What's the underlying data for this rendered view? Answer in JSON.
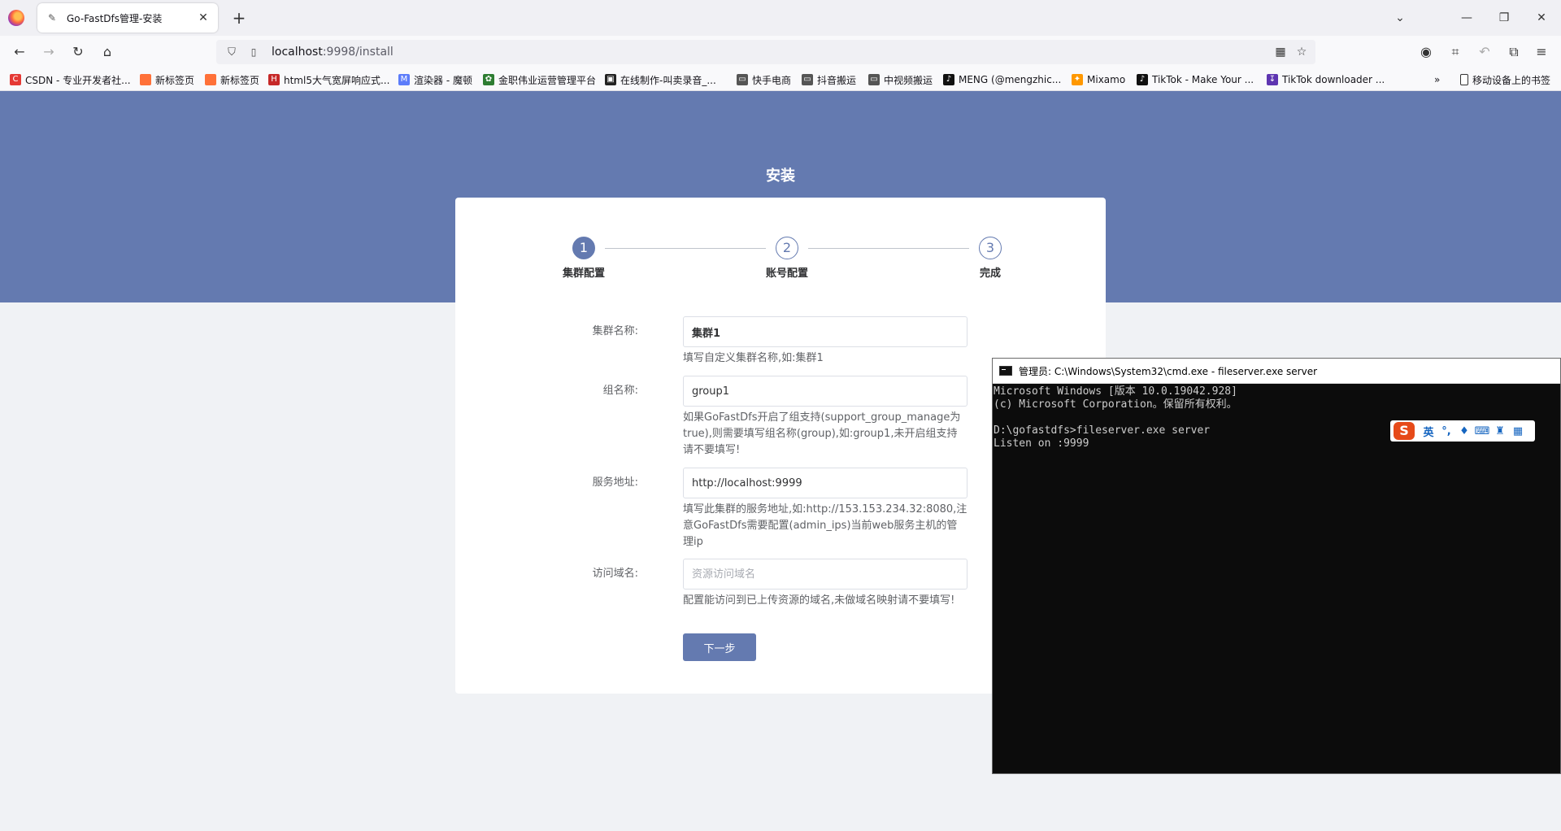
{
  "browser": {
    "tab_title": "Go-FastDfs管理-安装",
    "url_host": "localhost",
    "url_path": ":9998/install",
    "bookmarks": [
      {
        "label": "CSDN - 专业开发者社...",
        "icon": "C",
        "color": "#e53935"
      },
      {
        "label": "新标签页",
        "icon": "",
        "color": "#ff7139"
      },
      {
        "label": "新标签页",
        "icon": "",
        "color": "#ff7139"
      },
      {
        "label": "html5大气宽屏响应式...",
        "icon": "H",
        "color": "#c62828"
      },
      {
        "label": "渲染器 - 魔顿",
        "icon": "M",
        "color": "#5c7cfa"
      },
      {
        "label": "金职伟业运营管理平台",
        "icon": "✿",
        "color": "#2e7d32"
      },
      {
        "label": "在线制作-叫卖录音_...",
        "icon": "▣",
        "color": "#222222"
      },
      {
        "label": "快手电商",
        "icon": "▭",
        "color": "#555555"
      },
      {
        "label": "抖音搬运",
        "icon": "▭",
        "color": "#555555"
      },
      {
        "label": "中视频搬运",
        "icon": "▭",
        "color": "#555555"
      },
      {
        "label": "MENG (@mengzhic...",
        "icon": "♪",
        "color": "#111111"
      },
      {
        "label": "Mixamo",
        "icon": "✦",
        "color": "#ff9800"
      },
      {
        "label": "TikTok - Make Your ...",
        "icon": "♪",
        "color": "#111111"
      },
      {
        "label": "TikTok downloader ...",
        "icon": "↧",
        "color": "#5e35b1"
      }
    ],
    "mobile_bookmarks": "移动设备上的书签"
  },
  "page": {
    "heading": "安装",
    "steps": [
      {
        "num": "1",
        "label": "集群配置"
      },
      {
        "num": "2",
        "label": "账号配置"
      },
      {
        "num": "3",
        "label": "完成"
      }
    ],
    "fields": [
      {
        "label": "集群名称:",
        "value": "集群1",
        "placeholder": "",
        "hint": "填写自定义集群名称,如:集群1"
      },
      {
        "label": "组名称:",
        "value": "group1",
        "placeholder": "",
        "hint": "如果GoFastDfs开启了组支持(support_group_manage为true),则需要填写组名称(group),如:group1,未开启组支持请不要填写!"
      },
      {
        "label": "服务地址:",
        "value": "http://localhost:9999",
        "placeholder": "",
        "hint": "填写此集群的服务地址,如:http://153.153.234.32:8080,注意GoFastDfs需要配置(admin_ips)当前web服务主机的管理ip"
      },
      {
        "label": "访问域名:",
        "value": "",
        "placeholder": "资源访问域名",
        "hint": "配置能访问到已上传资源的域名,未做域名映射请不要填写!"
      }
    ],
    "next_button": "下一步"
  },
  "cmd": {
    "title": "管理员: C:\\Windows\\System32\\cmd.exe - fileserver.exe  server",
    "lines": "Microsoft Windows [版本 10.0.19042.928]\n(c) Microsoft Corporation。保留所有权利。\n\nD:\\gofastdfs>fileserver.exe server\nListen on :9999"
  },
  "ime": {
    "logo": "S",
    "mode": "英"
  }
}
